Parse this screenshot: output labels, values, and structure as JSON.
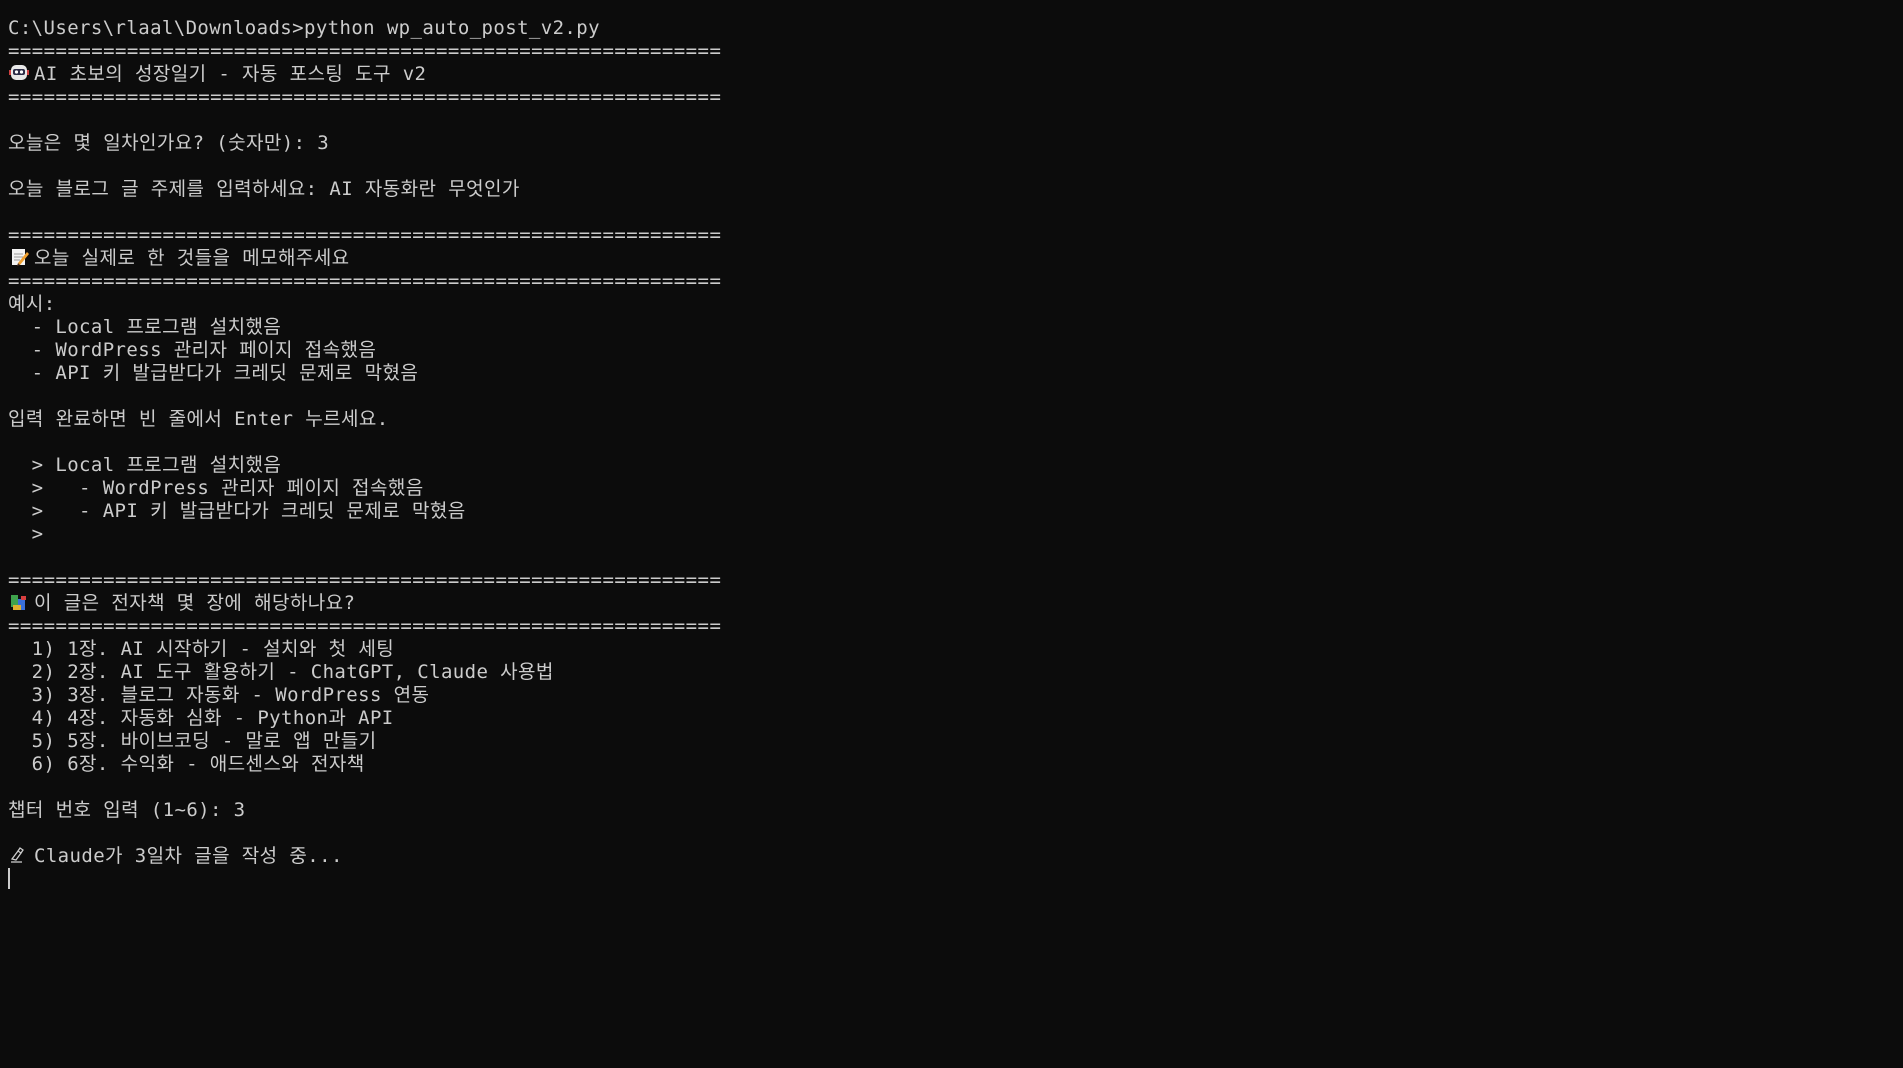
{
  "terminal": {
    "command_line": "C:\\Users\\rlaal\\Downloads>python wp_auto_post_v2.py",
    "separator": "============================================================",
    "header_title": "AI 초보의 성장일기 - 자동 포스팅 도구 v2",
    "prompt_day": "오늘은 몇 일차인가요? (숫자만): 3",
    "prompt_topic": "오늘 블로그 글 주제를 입력하세요: AI 자동화란 무엇인가",
    "memo_title": "오늘 실제로 한 것들을 메모해주세요",
    "example_label": "예시:",
    "examples": [
      "  - Local 프로그램 설치했음",
      "  - WordPress 관리자 페이지 접속했음",
      "  - API 키 발급받다가 크레딧 문제로 막혔음"
    ],
    "input_hint": "입력 완료하면 빈 줄에서 Enter 누르세요.",
    "inputs": [
      "  > Local 프로그램 설치했음",
      "  >   - WordPress 관리자 페이지 접속했음",
      "  >   - API 키 발급받다가 크레딧 문제로 막혔음",
      "  >"
    ],
    "chapter_question": "이 글은 전자책 몇 장에 해당하나요?",
    "chapters": [
      "  1) 1장. AI 시작하기 - 설치와 첫 세팅",
      "  2) 2장. AI 도구 활용하기 - ChatGPT, Claude 사용법",
      "  3) 3장. 블로그 자동화 - WordPress 연동",
      "  4) 4장. 자동화 심화 - Python과 API",
      "  5) 5장. 바이브코딩 - 말로 앱 만들기",
      "  6) 6장. 수익화 - 애드센스와 전자책"
    ],
    "chapter_prompt": "챕터 번호 입력 (1~6): 3",
    "status_line": "Claude가 3일차 글을 작성 중...",
    "icons": {
      "header": "robot-face-icon",
      "memo": "memo-icon",
      "chapter": "books-icon",
      "writing": "writing-hand-icon"
    },
    "colors": {
      "background": "#0c0c0c",
      "text": "#cccccc"
    }
  }
}
